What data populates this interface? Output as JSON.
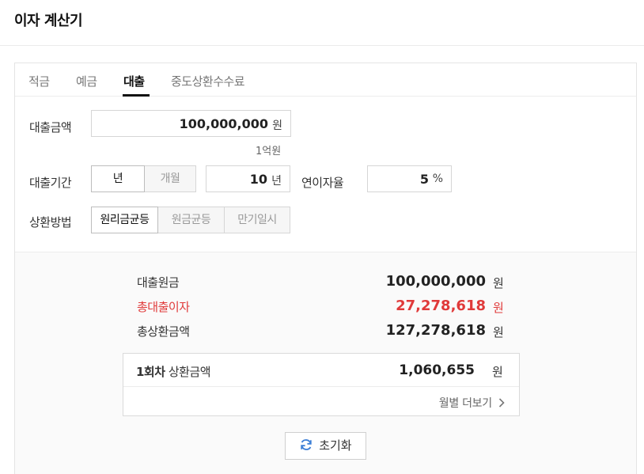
{
  "page": {
    "title": "이자 계산기"
  },
  "tabs": [
    {
      "label": "적금"
    },
    {
      "label": "예금"
    },
    {
      "label": "대출"
    },
    {
      "label": "중도상환수수료"
    }
  ],
  "active_tab": "대출",
  "form": {
    "loan_amount": {
      "label": "대출금액",
      "value": "100,000,000",
      "unit": "원",
      "hint": "1억원"
    },
    "loan_period": {
      "label": "대출기간",
      "options": [
        "년",
        "개월"
      ],
      "selected": "년",
      "value": "10",
      "unit": "년"
    },
    "interest_rate": {
      "label": "연이자율",
      "value": "5",
      "unit": "%"
    },
    "repayment": {
      "label": "상환방법",
      "options": [
        "원리금균등",
        "원금균등",
        "만기일시"
      ],
      "selected": "원리금균등"
    }
  },
  "result": {
    "principal": {
      "label": "대출원금",
      "value": "100,000,000",
      "unit": "원"
    },
    "total_interest": {
      "label": "총대출이자",
      "value": "27,278,618",
      "unit": "원"
    },
    "total_repayment": {
      "label": "총상환금액",
      "value": "127,278,618",
      "unit": "원"
    },
    "installment": {
      "label_strong": "1회차",
      "label_rest": " 상환금액",
      "value": "1,060,655",
      "unit": "원"
    },
    "monthly_more": "월별 더보기"
  },
  "reset_label": "초기화",
  "colors": {
    "accent_red": "#e03a3a",
    "refresh_icon": "#3d7fd6"
  }
}
